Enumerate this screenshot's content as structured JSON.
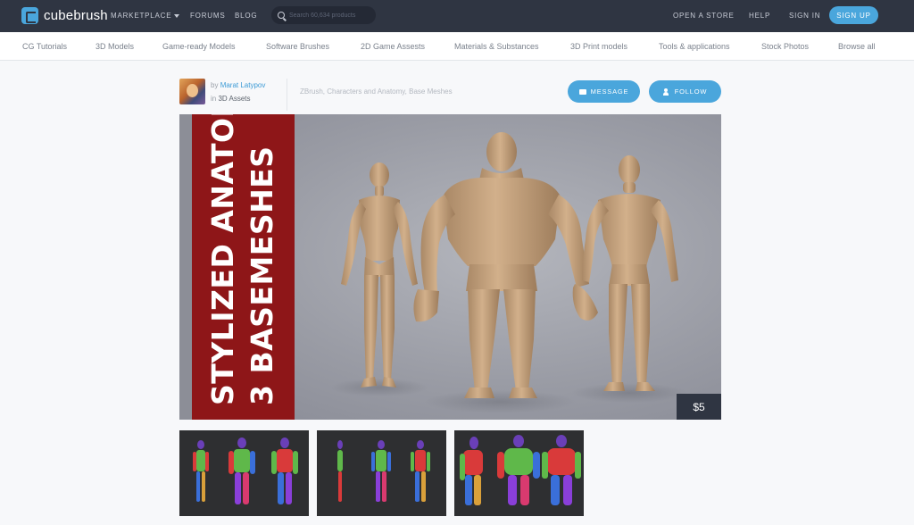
{
  "header": {
    "logo_text": "cubebrush",
    "nav": {
      "marketplace": "MARKETPLACE",
      "forums": "FORUMS",
      "blog": "BLOG",
      "open_store": "OPEN A STORE",
      "help": "HELP",
      "sign_in": "SIGN IN",
      "sign_up": "SIGN UP"
    },
    "search_placeholder": "Search 60,634 products"
  },
  "categories": [
    "CG Tutorials",
    "3D Models",
    "Game-ready Models",
    "Software Brushes",
    "2D Game Assests",
    "Materials & Substances",
    "3D Print models",
    "Tools & applications",
    "Stock Photos",
    "Browse all"
  ],
  "product": {
    "by_prefix": "by",
    "author": "Marat Latypov",
    "in_prefix": "in",
    "category": "3D Assets",
    "tags": "ZBrush, Characters and Anatomy, Base Meshes",
    "message_label": "MESSAGE",
    "follow_label": "FOLLOW",
    "hero_title_line1": "STYLIZED ANATOMY",
    "hero_title_line2": "3 BASEMESHES",
    "price": "$5"
  },
  "colors": {
    "topbar": "#2f3542",
    "accent": "#4aa6dc",
    "hero_red": "#8e1618",
    "clay": "#c29f78"
  },
  "icons": {
    "logo": "cube-logo-icon",
    "search": "search-icon",
    "message": "envelope-icon",
    "follow": "user-plus-icon",
    "marketplace_caret": "chevron-down-icon"
  }
}
